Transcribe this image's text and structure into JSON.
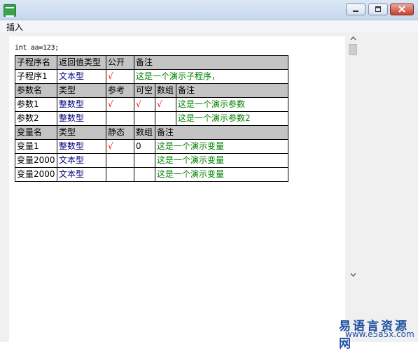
{
  "menu": {
    "insert_label": "插入"
  },
  "code_line": "int aa=123;",
  "check_mark": "√",
  "subprogram": {
    "headers": [
      "子程序名",
      "返回值类型",
      "公开",
      "备注"
    ],
    "row": {
      "name": "子程序1",
      "return_type": "文本型",
      "public": true,
      "remark": "这是一个演示子程序，"
    }
  },
  "params": {
    "headers": [
      "参数名",
      "类型",
      "参考",
      "可空",
      "数组",
      "备注"
    ],
    "rows": [
      {
        "name": "参数1",
        "type": "整数型",
        "reference": true,
        "nullable": true,
        "array": true,
        "remark": "这是一个演示参数"
      },
      {
        "name": "参数2",
        "type": "整数型",
        "reference": false,
        "nullable": false,
        "array": false,
        "remark": "这是一个演示参数2"
      }
    ]
  },
  "variables": {
    "headers": [
      "变量名",
      "类型",
      "静态",
      "数组",
      "备注"
    ],
    "rows": [
      {
        "name": "变量1",
        "type": "整数型",
        "static": true,
        "array": "0",
        "remark": "这是一个演示变量"
      },
      {
        "name": "变量2000",
        "type": "文本型",
        "static": false,
        "array": "",
        "remark": "这是一个演示变量"
      },
      {
        "name": "变量2000",
        "type": "文本型",
        "static": false,
        "array": "",
        "remark": "这是一个演示变量"
      }
    ]
  },
  "watermark": {
    "brand": "易语言资源网",
    "url": "www.e5a5x.com"
  },
  "colors": {
    "header_bg": "#c4c4c4",
    "type_text": "#000080",
    "remark_text": "#008000",
    "check": "#ff0000",
    "watermark": "#1e4fa0"
  },
  "icons": {
    "app": "app-logo-icon",
    "minimize": "minimize-icon",
    "maximize": "maximize-icon",
    "close": "close-icon",
    "scroll_up": "scroll-up-icon",
    "scroll_down": "scroll-down-icon"
  }
}
